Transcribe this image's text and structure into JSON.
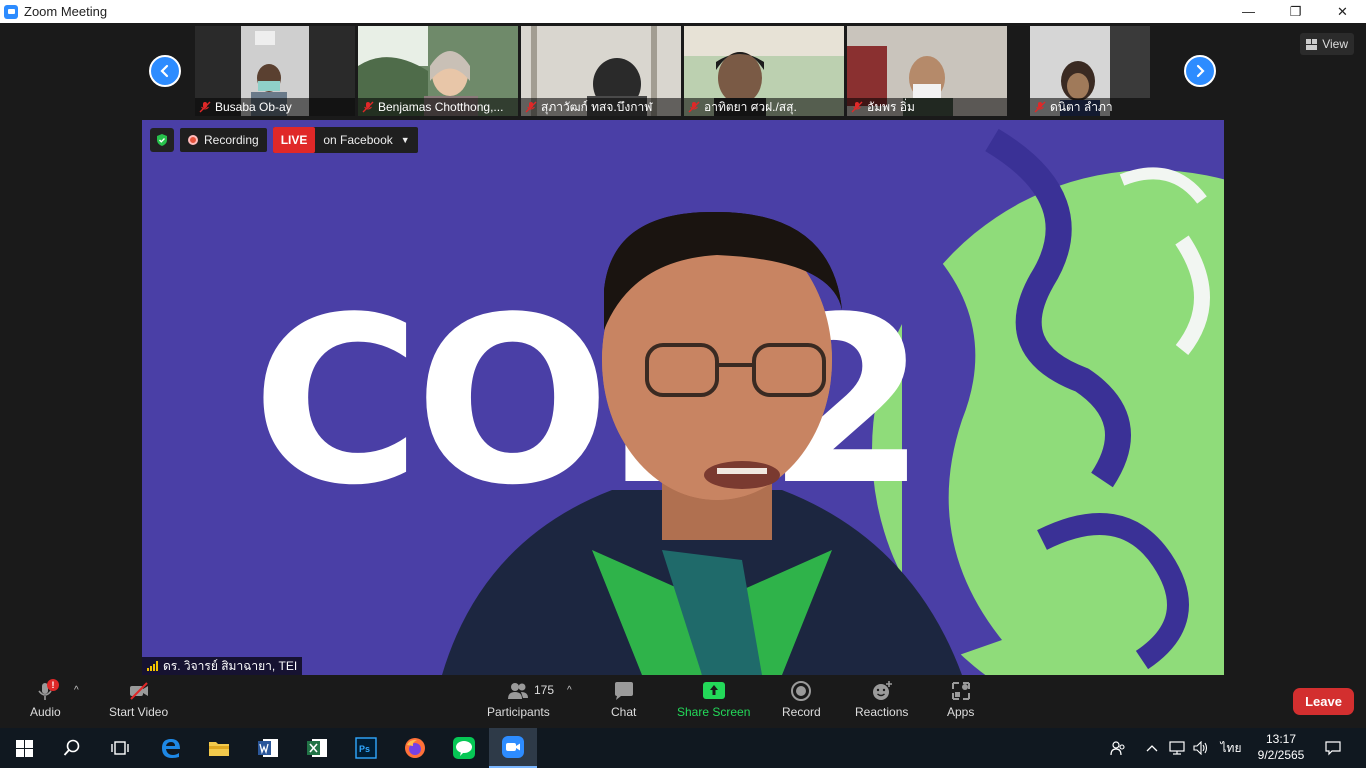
{
  "window": {
    "title": "Zoom Meeting",
    "minimize": "—",
    "restore": "❐",
    "close": "✕"
  },
  "strip": {
    "view_label": "View",
    "participants": [
      {
        "name": "Busaba Ob-ay"
      },
      {
        "name": "Benjamas Chotthong,..."
      },
      {
        "name": "สุภาวัฒก์ ทสจ.บึงกาฬ"
      },
      {
        "name": "อาทิตยา ศวฝ./สสุ."
      },
      {
        "name": "อัมพร อิ่ม"
      },
      {
        "name": "ดนิตา ลำภา"
      }
    ]
  },
  "main": {
    "recording_label": "Recording",
    "live_label": "LIVE",
    "live_target": "on Facebook",
    "speaker_name": "ดร. วิจารย์ สิมาฉายา, TEI",
    "background_text": "COP2"
  },
  "toolbar": {
    "audio": "Audio",
    "audio_badge": "!",
    "start_video": "Start Video",
    "participants": "Participants",
    "participants_count": "175",
    "chat": "Chat",
    "share_screen": "Share Screen",
    "record": "Record",
    "reactions": "Reactions",
    "apps": "Apps",
    "leave": "Leave",
    "share_color": "#23d959",
    "leave_color": "#d32f2f"
  },
  "taskbar": {
    "language": "ไทย",
    "time": "13:17",
    "date": "9/2/2565"
  },
  "colors": {
    "accent": "#2d8cff",
    "live": "#e02828"
  }
}
